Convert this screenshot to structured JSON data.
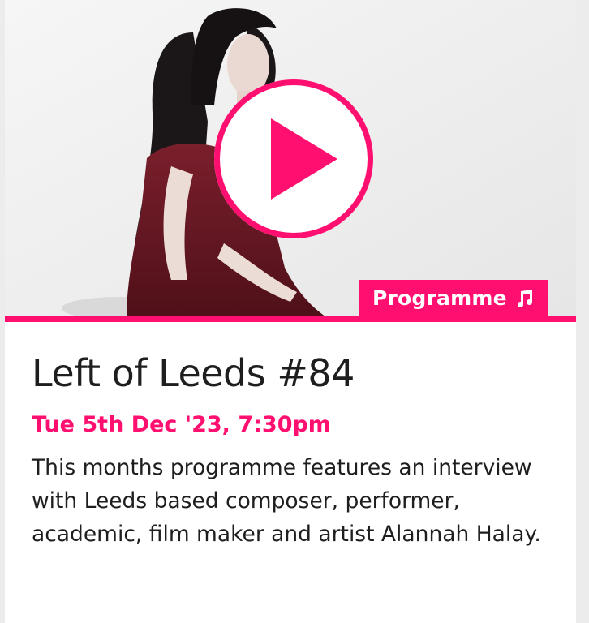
{
  "event": {
    "media": {
      "image_alt": "Photo of Alannah Halay",
      "play_icon": "play-icon"
    },
    "badge": {
      "label": "Programme",
      "icon": "music-note-icon"
    },
    "title": "Left of Leeds #84",
    "date": "Tue 5th Dec '23, 7:30pm",
    "description": "This months programme features an interview with Leeds based composer, performer, academic, film maker and artist Alannah Halay."
  },
  "colors": {
    "accent": "#ff0f6f",
    "text": "#1e1e1e",
    "background": "#ffffff"
  }
}
